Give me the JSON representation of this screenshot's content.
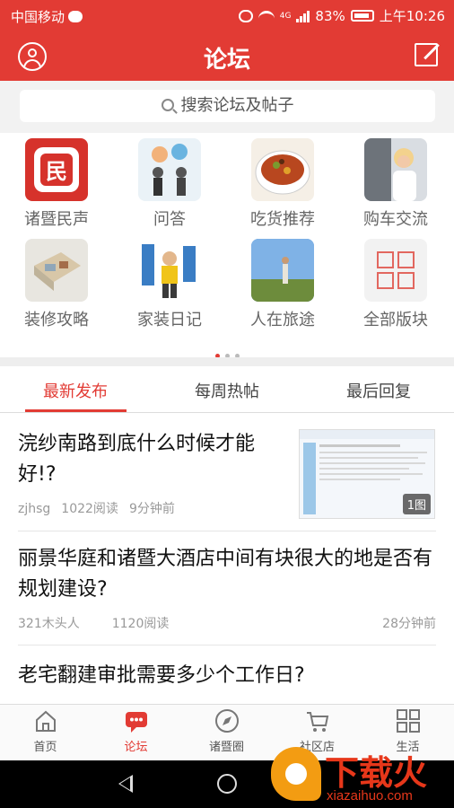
{
  "status_bar": {
    "carrier": "中国移动",
    "network": "4G",
    "battery": "83%",
    "time": "上午10:26"
  },
  "header": {
    "title": "论坛",
    "left_icon": "user-icon",
    "right_icon": "edit-icon"
  },
  "search": {
    "placeholder": "搜索论坛及帖子"
  },
  "categories": [
    {
      "label": "诸暨民声",
      "icon": "zhuji-minsheng-logo"
    },
    {
      "label": "问答",
      "icon": "qa-people-image"
    },
    {
      "label": "吃货推荐",
      "icon": "food-bowl-image"
    },
    {
      "label": "购车交流",
      "icon": "car-woman-image"
    },
    {
      "label": "装修攻略",
      "icon": "floorplan-image"
    },
    {
      "label": "家装日记",
      "icon": "worker-image"
    },
    {
      "label": "人在旅途",
      "icon": "travel-image"
    },
    {
      "label": "全部版块",
      "icon": "grid-icon"
    }
  ],
  "carousel": {
    "page": 1,
    "pages": 3
  },
  "tabs": [
    {
      "label": "最新发布",
      "active": true
    },
    {
      "label": "每周热帖",
      "active": false
    },
    {
      "label": "最后回复",
      "active": false
    }
  ],
  "posts": [
    {
      "title": "浣纱南路到底什么时候才能好!?",
      "author": "zjhsg",
      "reads": "1022阅读",
      "time": "9分钟前",
      "image_badge": "1图"
    },
    {
      "title": "丽景华庭和诸暨大酒店中间有块很大的地是否有规划建设?",
      "author": "321木头人",
      "reads": "1120阅读",
      "time": "28分钟前"
    },
    {
      "title": "老宅翻建审批需要多少个工作日?"
    }
  ],
  "bottom_nav": [
    {
      "label": "首页",
      "icon": "home-icon",
      "active": false
    },
    {
      "label": "论坛",
      "icon": "forum-icon",
      "active": true
    },
    {
      "label": "诸暨圈",
      "icon": "compass-icon",
      "active": false
    },
    {
      "label": "社区店",
      "icon": "cart-icon",
      "active": false
    },
    {
      "label": "生活",
      "icon": "apps-icon",
      "active": false
    }
  ],
  "watermark": {
    "text": "下载火",
    "subtext": "xiazaihuo.com"
  },
  "colors": {
    "accent": "#e23b34",
    "background": "#ffffff",
    "separator": "#eeeeee"
  }
}
